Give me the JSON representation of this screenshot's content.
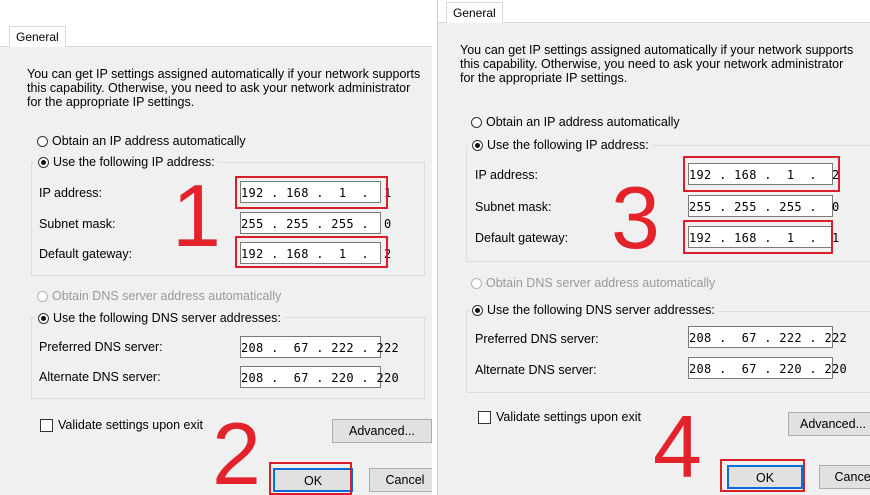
{
  "left": {
    "tab_label": "General",
    "description": "You can get IP settings assigned automatically if your network supports\nthis capability. Otherwise, you need to ask your network administrator\nfor the appropriate IP settings.",
    "radio_obtain_ip": "Obtain an IP address automatically",
    "radio_use_ip": "Use the following IP address:",
    "ip_label": "IP address:",
    "ip_value": "192 . 168 .  1  .  1",
    "subnet_label": "Subnet mask:",
    "subnet_value": "255 . 255 . 255 .  0",
    "gateway_label": "Default gateway:",
    "gateway_value": "192 . 168 .  1  .  2",
    "radio_obtain_dns": "Obtain DNS server address automatically",
    "radio_use_dns": "Use the following DNS server addresses:",
    "preferred_label": "Preferred DNS server:",
    "preferred_value": "208 .  67 . 222 . 222",
    "alternate_label": "Alternate DNS server:",
    "alternate_value": "208 .  67 . 220 . 220",
    "validate_label": "Validate settings upon exit",
    "advanced_label": "Advanced...",
    "ok_label": "OK",
    "cancel_label": "Cancel",
    "step_a": "1",
    "step_b": "2"
  },
  "right": {
    "tab_label": "General",
    "description": "You can get IP settings assigned automatically if your network supports\nthis capability. Otherwise, you need to ask your network administrator\nfor the appropriate IP settings.",
    "radio_obtain_ip": "Obtain an IP address automatically",
    "radio_use_ip": "Use the following IP address:",
    "ip_label": "IP address:",
    "ip_value": "192 . 168 .  1  .  2",
    "subnet_label": "Subnet mask:",
    "subnet_value": "255 . 255 . 255 .  0",
    "gateway_label": "Default gateway:",
    "gateway_value": "192 . 168 .  1  .  1",
    "radio_obtain_dns": "Obtain DNS server address automatically",
    "radio_use_dns": "Use the following DNS server addresses:",
    "preferred_label": "Preferred DNS server:",
    "preferred_value": "208 .  67 . 222 . 222",
    "alternate_label": "Alternate DNS server:",
    "alternate_value": "208 .  67 . 220 . 220",
    "validate_label": "Validate settings upon exit",
    "advanced_label": "Advanced...",
    "ok_label": "OK",
    "cancel_label": "Cancel",
    "step_a": "3",
    "step_b": "4"
  },
  "colors": {
    "highlight": "#d6202a",
    "step_number": "#e3222c",
    "dialog_bg": "#f0f0f0",
    "ok_focus": "#0a6cd8"
  }
}
